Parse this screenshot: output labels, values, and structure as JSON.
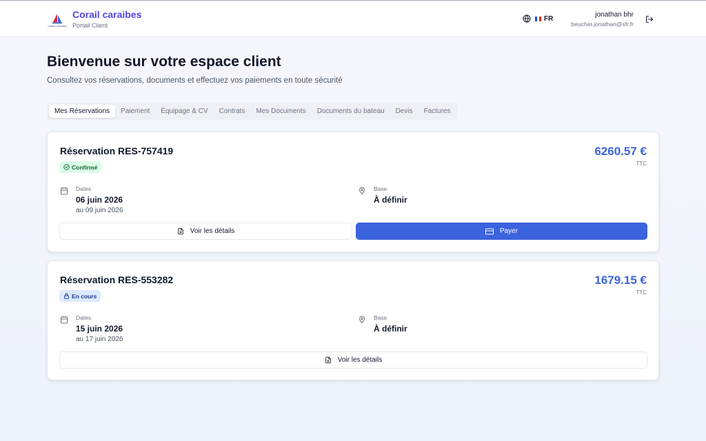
{
  "brand": {
    "title": "Corail caraibes",
    "subtitle": "Portail Client",
    "logo_text": "CORAIL CARAIBES"
  },
  "header": {
    "language": "FR",
    "user_name": "jonathan bhr",
    "user_email": "beucher.jonathan@sfr.fr"
  },
  "welcome": {
    "title": "Bienvenue sur votre espace client",
    "subtitle": "Consultez vos réservations, documents et effectuez vos paiements en toute sécurité"
  },
  "tabs": [
    "Mes Réservations",
    "Paiement",
    "Équipage & CV",
    "Contrats",
    "Mes Documents",
    "Documents du bateau",
    "Devis",
    "Factures"
  ],
  "reservations": [
    {
      "title": "Réservation RES-757419",
      "status": "Confirmé",
      "price": "6260.57 €",
      "price_suffix": "TTC",
      "dates_label": "Dates",
      "date_start": "06 juin 2026",
      "date_end": "au 09 juin 2026",
      "base_label": "Base",
      "base_value": "À définir",
      "details_button": "Voir les détails",
      "pay_button": "Payer"
    },
    {
      "title": "Réservation RES-553282",
      "status": "En cours",
      "price": "1679.15 €",
      "price_suffix": "TTC",
      "dates_label": "Dates",
      "date_start": "15 juin 2026",
      "date_end": "au 17 juin 2026",
      "base_label": "Base",
      "base_value": "À définir",
      "details_button": "Voir les détails"
    }
  ],
  "colors": {
    "brand": "#4f46e5",
    "primary": "#3b63dd",
    "confirmed_bg": "#dcfce7",
    "in_progress_bg": "#dbeafe"
  },
  "icons": [
    "globe-icon",
    "france-flag-icon",
    "logout-icon",
    "calendar-icon",
    "map-pin-icon",
    "document-icon",
    "credit-card-icon",
    "check-circle-icon",
    "lock-icon"
  ]
}
